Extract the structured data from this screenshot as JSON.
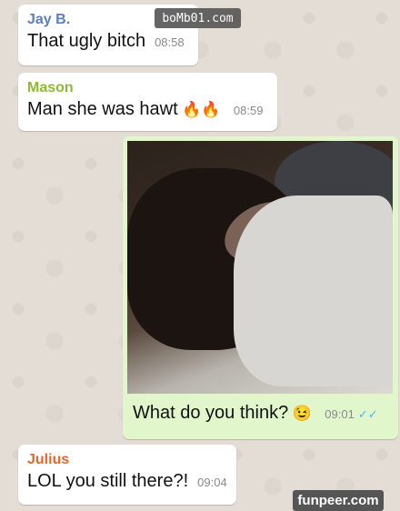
{
  "watermarks": {
    "top": "boMb01.com",
    "bottom": "funpeer.com"
  },
  "messages": [
    {
      "sender": "Jay B.",
      "sender_color": "#5b7fbf",
      "text": "That ugly bitch",
      "time": "08:58"
    },
    {
      "sender": "Mason",
      "sender_color": "#8fba2f",
      "text": "Man she was hawt",
      "emoji": "🔥🔥",
      "time": "08:59"
    },
    {
      "caption": "What do you think?",
      "emoji": "😉",
      "time": "09:01",
      "ticks": "✓✓"
    },
    {
      "sender": "Julius",
      "sender_color": "#e0692b",
      "text": "LOL you still there?!",
      "time": "09:04"
    }
  ]
}
